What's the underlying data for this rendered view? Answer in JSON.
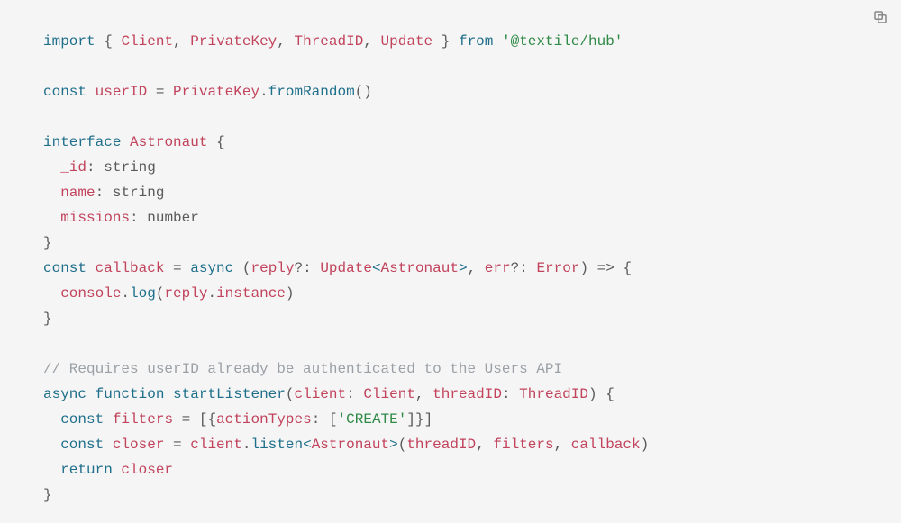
{
  "copy_label": "Copy",
  "tokens": {
    "kw_import": "import",
    "kw_from": "from",
    "kw_const": "const",
    "kw_interface": "interface",
    "kw_async": "async",
    "kw_function": "function",
    "kw_return": "return",
    "cls_Client": "Client",
    "cls_PrivateKey": "PrivateKey",
    "cls_ThreadID": "ThreadID",
    "cls_Update": "Update",
    "cls_Astronaut": "Astronaut",
    "cls_Error": "Error",
    "id_userID": "userID",
    "id_callback": "callback",
    "id_startListener": "startListener",
    "id_filters": "filters",
    "id_closer": "closer",
    "id_id": "_id",
    "id_name": "name",
    "id_missions": "missions",
    "id_reply": "reply",
    "id_err": "err",
    "id_client": "client",
    "id_threadID": "threadID",
    "id_console": "console",
    "fn_fromRandom": "fromRandom",
    "fn_log": "log",
    "fn_listen": "listen",
    "prop_instance": "instance",
    "prop_actionTypes": "actionTypes",
    "type_string": "string",
    "type_number": "number",
    "str_hub": "'@textile/hub'",
    "str_create": "'CREATE'",
    "comment": "// Requires userID already be authenticated to the Users API",
    "p_lbrace": "{",
    "p_rbrace": "}",
    "p_lparen": "(",
    "p_rparen": "()",
    "p_rparen1": ")",
    "p_lbracket": "[",
    "p_rbracket": "]",
    "p_comma": ",",
    "p_colon": ":",
    "p_eq": " = ",
    "p_arrow": " => ",
    "p_dot": ".",
    "p_q": "?",
    "p_lt": "<",
    "p_gt": ">"
  }
}
